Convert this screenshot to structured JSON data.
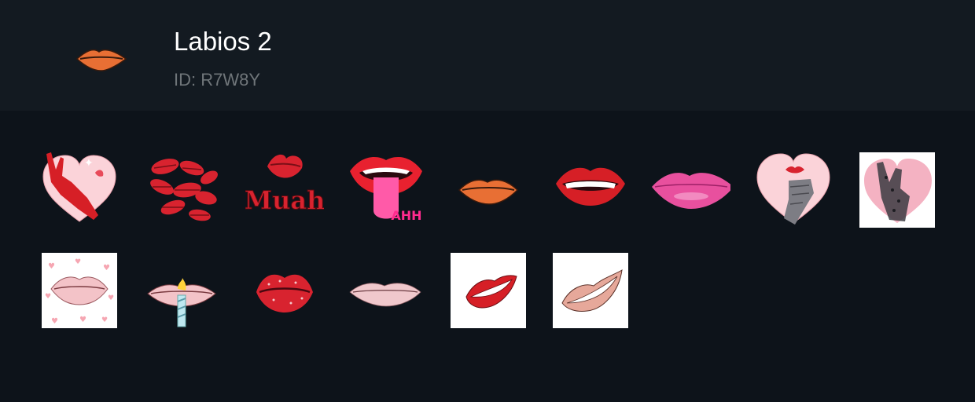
{
  "pack": {
    "title": "Labios 2",
    "id_text": "ID: R7W8Y",
    "icon": "orange-lips-icon"
  },
  "stickers": [
    {
      "name": "sticker-red-hand-heart",
      "icon": "red-hand-heart-icon"
    },
    {
      "name": "sticker-kiss-prints",
      "icon": "kiss-prints-icon"
    },
    {
      "name": "sticker-muah",
      "icon": "muah-lips-icon",
      "text": "Muah"
    },
    {
      "name": "sticker-tongue-ahh",
      "icon": "tongue-lips-icon",
      "text": "AHH"
    },
    {
      "name": "sticker-orange-lips",
      "icon": "orange-lips-icon"
    },
    {
      "name": "sticker-red-smile",
      "icon": "red-smile-lips-icon"
    },
    {
      "name": "sticker-pink-lips",
      "icon": "pink-lips-icon"
    },
    {
      "name": "sticker-heart-hand-lips",
      "icon": "heart-hand-lips-icon"
    },
    {
      "name": "sticker-lace-glove-heart",
      "icon": "lace-glove-heart-icon"
    },
    {
      "name": "sticker-lips-hearts",
      "icon": "lips-hearts-icon"
    },
    {
      "name": "sticker-candle-lips",
      "icon": "candle-lips-icon"
    },
    {
      "name": "sticker-glitter-lips",
      "icon": "glitter-lips-icon"
    },
    {
      "name": "sticker-pale-lips",
      "icon": "pale-lips-icon"
    },
    {
      "name": "sticker-drawn-red-lips",
      "icon": "drawn-red-lips-icon"
    },
    {
      "name": "sticker-drawn-nude-lips",
      "icon": "drawn-nude-lips-icon"
    }
  ],
  "colors": {
    "background": "#0d131a",
    "header": "#131a21",
    "title": "#ffffff",
    "id_text": "#6f7579",
    "lip_red": "#d8232f",
    "lip_orange": "#e86f34",
    "lip_pink": "#e8509e",
    "heart_pink": "#fbd3d9"
  }
}
